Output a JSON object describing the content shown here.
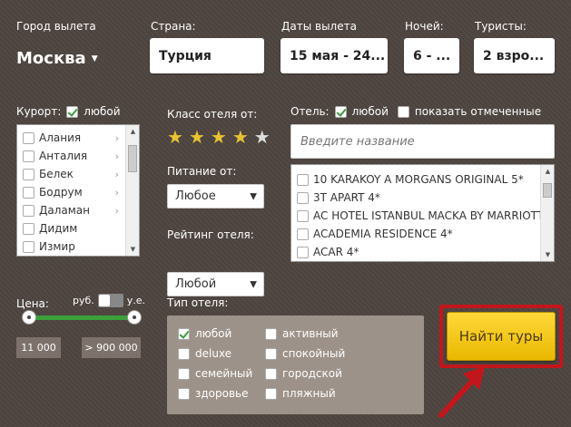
{
  "header": {
    "city_label": "Город вылета",
    "city_value": "Москва",
    "country_label": "Страна:",
    "country_value": "Турция",
    "dates_label": "Даты вылета",
    "dates_value": "15 мая - 24...",
    "nights_label": "Ночей:",
    "nights_value": "6 - ...",
    "tourists_label": "Туристы:",
    "tourists_value": "2 взро..."
  },
  "resort": {
    "label": "Курорт:",
    "any_label": "любой",
    "any_checked": true,
    "items": [
      {
        "label": "Алания",
        "has_sub": true
      },
      {
        "label": "Анталия",
        "has_sub": true
      },
      {
        "label": "Белек",
        "has_sub": true
      },
      {
        "label": "Бодрум",
        "has_sub": true
      },
      {
        "label": "Даламан",
        "has_sub": true
      },
      {
        "label": "Дидим",
        "has_sub": false
      },
      {
        "label": "Измир",
        "has_sub": false
      }
    ]
  },
  "hotel_class": {
    "label": "Класс отеля от:",
    "stars_selected": 4,
    "stars_total": 5
  },
  "meals": {
    "label": "Питание от:",
    "value": "Любое"
  },
  "rating": {
    "label": "Рейтинг отеля:",
    "value": "Любой"
  },
  "hotel": {
    "label": "Отель:",
    "any_label": "любой",
    "any_checked": true,
    "show_marked_label": "показать отмеченные",
    "show_marked_checked": false,
    "search_placeholder": "Введите название",
    "items": [
      "10 KARAKOY A MORGANS ORIGINAL 5*",
      "3T APART 4*",
      "AC HOTEL ISTANBUL MACKA BY MARRIOTT",
      "ACADEMIA RESIDENCE 4*",
      "ACAR 4*"
    ]
  },
  "price": {
    "label": "Цена:",
    "currency_rub": "руб.",
    "currency_ue": "у.е.",
    "min": "11 000",
    "max": "> 900 000",
    "slider_min_fraction": 0,
    "slider_max_fraction": 1
  },
  "hotel_type": {
    "label": "Тип отеля:",
    "col1": [
      {
        "label": "любой",
        "checked": true
      },
      {
        "label": "deluxe",
        "checked": false
      },
      {
        "label": "семейный",
        "checked": false
      },
      {
        "label": "здоровье",
        "checked": false
      }
    ],
    "col2": [
      {
        "label": "активный",
        "checked": false
      },
      {
        "label": "спокойный",
        "checked": false
      },
      {
        "label": "городской",
        "checked": false
      },
      {
        "label": "пляжный",
        "checked": false
      }
    ]
  },
  "search_button": {
    "label": "Найти туры"
  },
  "colors": {
    "background": "#4e4540",
    "accent_yellow": "#f2c200",
    "highlight_red": "#c3161c",
    "slider_green": "#3aa03a"
  }
}
